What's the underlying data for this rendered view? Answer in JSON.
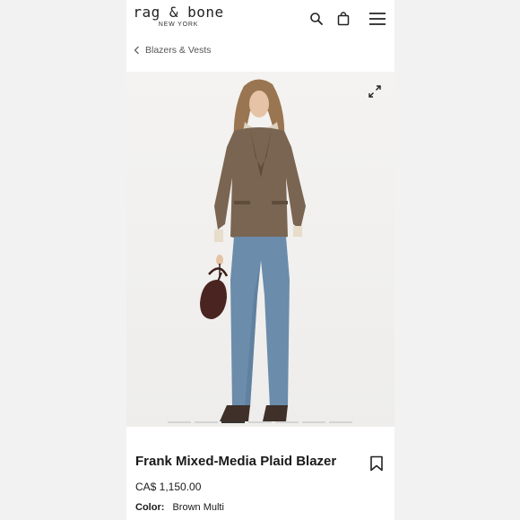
{
  "header": {
    "logo_main": "rag & bone",
    "logo_sub": "NEW YORK",
    "icons": [
      "search-icon",
      "bag-icon",
      "menu-icon"
    ]
  },
  "breadcrumb": {
    "label": "Blazers & Vests"
  },
  "gallery": {
    "image_count": 7,
    "active_index": 2
  },
  "product": {
    "title": "Frank Mixed-Media Plaid Blazer",
    "price": "CA$ 1,150.00",
    "color_label": "Color:",
    "color_value": "Brown Multi"
  },
  "colors": {
    "background": "#f2f2f2",
    "page": "#ffffff",
    "hero_bg": "#f4f3f1",
    "text": "#1a1a1a"
  }
}
